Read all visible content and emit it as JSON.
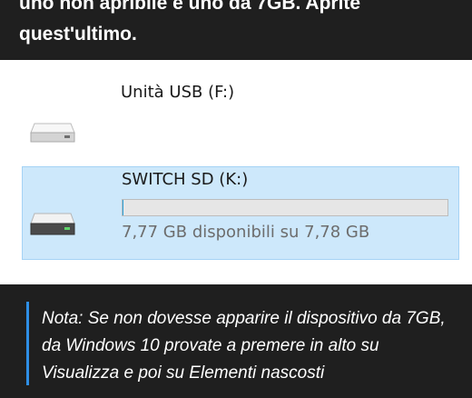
{
  "article": {
    "top_text": "uno non apribile e uno da 7GB. Aprite quest'ultimo."
  },
  "explorer": {
    "drives": [
      {
        "label": "Unità USB (F:)",
        "selected": false,
        "icon": "usb-drive-icon"
      },
      {
        "label": "SWITCH SD (K:)",
        "selected": true,
        "icon": "sd-drive-icon",
        "space_text": "7,77 GB disponibili su 7,78 GB",
        "used_fraction": 0.001
      }
    ],
    "colors": {
      "selection_bg": "#cde8fb",
      "selection_border": "#a5d3f5",
      "capacity_fill": "#26a0da"
    }
  },
  "note": {
    "text": "Nota: Se non dovesse apparire il dispositivo da 7GB, da Windows 10 provate a premere in alto su Visualizza e poi su Elementi nascosti",
    "accent_color": "#2e8fe6"
  }
}
